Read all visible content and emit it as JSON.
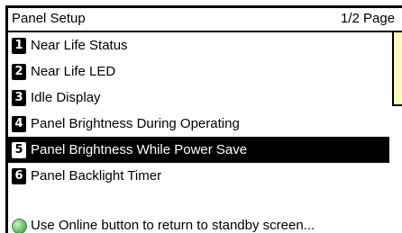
{
  "header": {
    "title": "Panel Setup",
    "page_indicator": "1/2 Page"
  },
  "menu": {
    "items": [
      {
        "number": "1",
        "label": "Near Life Status"
      },
      {
        "number": "2",
        "label": "Near Life LED"
      },
      {
        "number": "3",
        "label": "Idle Display"
      },
      {
        "number": "4",
        "label": "Panel Brightness During Operating"
      },
      {
        "number": "5",
        "label": "Panel Brightness While Power Save"
      },
      {
        "number": "6",
        "label": "Panel Backlight Timer"
      }
    ],
    "selected_index": 4
  },
  "footer": {
    "icon": "online-button-icon",
    "text": "Use Online button to return to standby screen..."
  },
  "colors": {
    "frame": "#000000",
    "selected_background": "#000000",
    "selected_text": "#ffffff",
    "online_icon": "#6cc36c",
    "side_panel": "#fffbc0"
  }
}
